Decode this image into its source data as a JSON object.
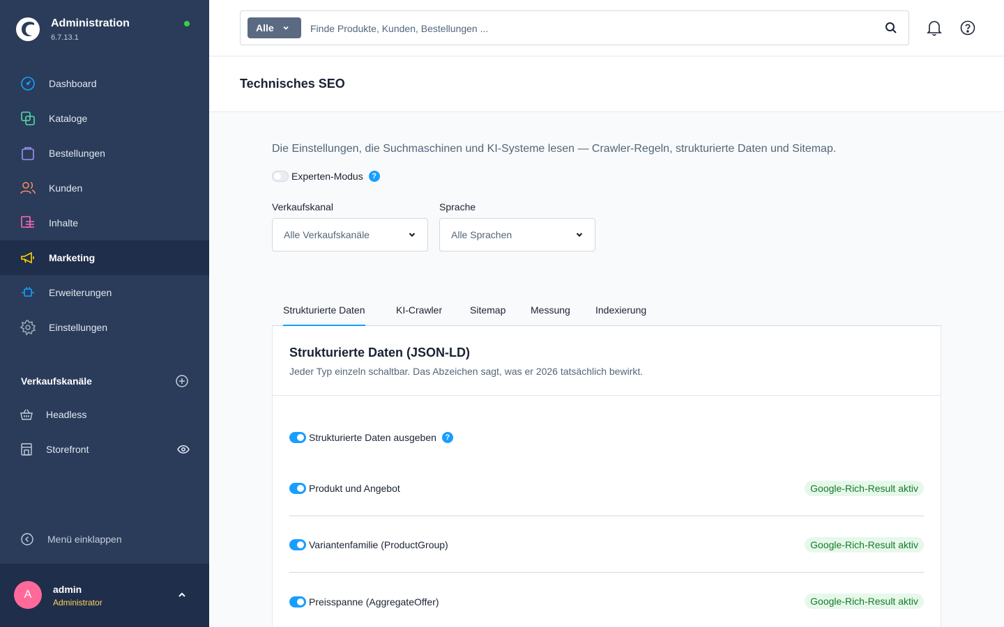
{
  "app": {
    "title": "Administration",
    "version": "6.7.13.1",
    "status_color": "#37d046"
  },
  "sidebar": {
    "items": [
      {
        "label": "Dashboard",
        "icon": "dashboard-icon",
        "color": "#189eff"
      },
      {
        "label": "Kataloge",
        "icon": "catalog-icon",
        "color": "#57d9a3"
      },
      {
        "label": "Bestellungen",
        "icon": "orders-icon",
        "color": "#a092f0"
      },
      {
        "label": "Kunden",
        "icon": "customers-icon",
        "color": "#f88962"
      },
      {
        "label": "Inhalte",
        "icon": "content-icon",
        "color": "#ff68b4"
      },
      {
        "label": "Marketing",
        "icon": "marketing-icon",
        "color": "#ffd700",
        "active": true
      },
      {
        "label": "Erweiterungen",
        "icon": "extensions-icon",
        "color": "#189eff"
      },
      {
        "label": "Einstellungen",
        "icon": "settings-icon",
        "color": "#9aa8b5"
      }
    ],
    "channels_title": "Verkaufskanäle",
    "channels": [
      {
        "label": "Headless",
        "icon": "basket-icon"
      },
      {
        "label": "Storefront",
        "icon": "storefront-icon"
      }
    ],
    "collapse_label": "Menü einklappen"
  },
  "user": {
    "initial": "A",
    "name": "admin",
    "role": "Administrator"
  },
  "search": {
    "scope": "Alle",
    "placeholder": "Finde Produkte, Kunden, Bestellungen ..."
  },
  "page": {
    "title": "Technisches SEO",
    "intro": "Die Einstellungen, die Suchmaschinen und KI-Systeme lesen — Crawler-Regeln, strukturierte Daten und Sitemap.",
    "expert_mode": {
      "label": "Experten-Modus",
      "enabled": false
    },
    "sales_channel": {
      "label": "Verkaufskanal",
      "value": "Alle Verkaufskanäle"
    },
    "language": {
      "label": "Sprache",
      "value": "Alle Sprachen"
    },
    "tabs": [
      "Strukturierte Daten",
      "KI-Crawler",
      "Sitemap",
      "Messung",
      "Indexierung"
    ],
    "active_tab": "Strukturierte Daten"
  },
  "card": {
    "title": "Strukturierte Daten (JSON-LD)",
    "subtitle": "Jeder Typ einzeln schaltbar. Das Abzeichen sagt, was er 2026 tatsächlich bewirkt.",
    "master": {
      "label": "Strukturierte Daten ausgeben",
      "enabled": true
    },
    "rows": [
      {
        "label": "Produkt und Angebot",
        "enabled": true,
        "badge": "Google-Rich-Result aktiv"
      },
      {
        "label": "Variantenfamilie (ProductGroup)",
        "enabled": true,
        "badge": "Google-Rich-Result aktiv"
      },
      {
        "label": "Preisspanne (AggregateOffer)",
        "enabled": true,
        "badge": "Google-Rich-Result aktiv"
      }
    ]
  }
}
